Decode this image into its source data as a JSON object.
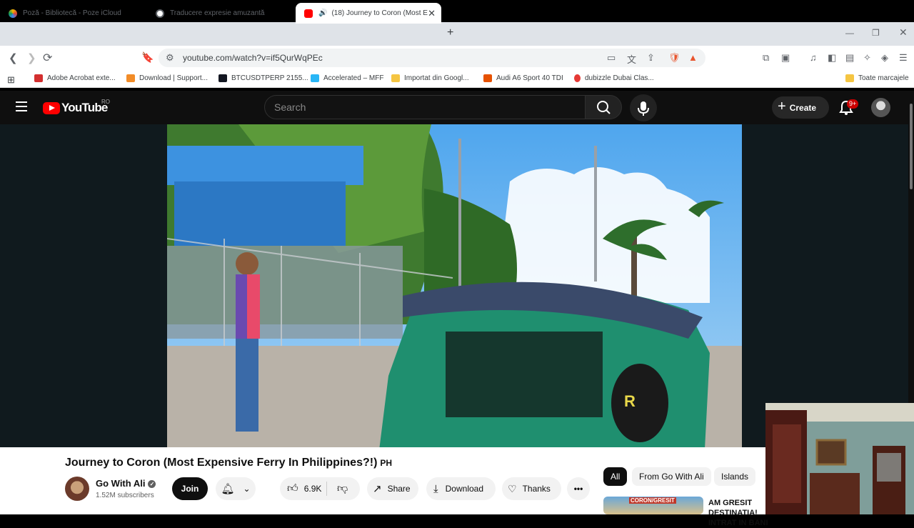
{
  "browser": {
    "tabs": [
      {
        "label": "Poză - Bibliotecă - Poze iCloud",
        "active": false
      },
      {
        "label": "Traducere expresie amuzantă",
        "active": false
      },
      {
        "label": "(18) Journey to Coron (Most E",
        "active": true
      }
    ],
    "address": "youtube.com/watch?v=if5QurWqPEc",
    "bookmarks": [
      "Adobe Acrobat exte...",
      "Download | Support...",
      "BTCUSDTPERP 2155...",
      "Accelerated – MFF",
      "Importat din Googl...",
      "Audi A6 Sport 40 TDI",
      "dubizzle Dubai Clas..."
    ],
    "all_bookmarks": "Toate marcajele"
  },
  "youtube": {
    "logo": "YouTube",
    "region": "RO",
    "search_placeholder": "Search",
    "create_label": "Create",
    "notif_count": "9+"
  },
  "video": {
    "title": "Journey to Coron (Most Expensive Ferry In Philippines?!)",
    "country": "PH",
    "channel": "Go With Ali",
    "subscribers": "1.52M subscribers",
    "join_label": "Join",
    "likes": "6.9K",
    "share_label": "Share",
    "download_label": "Download",
    "thanks_label": "Thanks"
  },
  "chips": [
    "All",
    "From Go With Ali",
    "Islands"
  ],
  "recommended": {
    "title": "AM GRESIT DESTINATIA! INTRAT IN BANI",
    "thumb_text": "CORON/GRESIT"
  },
  "colors": {
    "yt_red": "#ff0000",
    "dark_bg": "#0f0f0f",
    "tab_bg": "#dfe3e8"
  }
}
